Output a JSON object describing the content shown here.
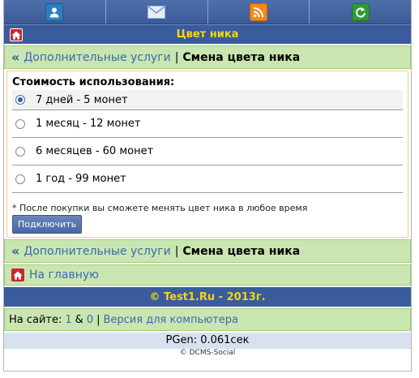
{
  "nav": {
    "icons": [
      "user-icon",
      "mail-icon",
      "rss-icon",
      "refresh-icon"
    ]
  },
  "titlebar": {
    "title": "Цвет ника"
  },
  "breadcrumb": {
    "parent": "Дополнительные услуги",
    "separator": "|",
    "current": "Смена цвета ника"
  },
  "form": {
    "label": "Стоимость использования:",
    "options": [
      {
        "label": "7 дней - 5 монет",
        "selected": true
      },
      {
        "label": "1 месяц - 12 монет",
        "selected": false
      },
      {
        "label": "6 месяцев - 60 монет",
        "selected": false
      },
      {
        "label": "1 год - 99 монет",
        "selected": false
      }
    ],
    "note": "* После покупки вы сможете менять цвет ника в любое время",
    "submit_label": "Подключить"
  },
  "home_link": "На главную",
  "footer": {
    "copyright": "© Test1.Ru - 2013г."
  },
  "online": {
    "prefix": "На сайте:",
    "count1": "1",
    "amp": "&",
    "count2": "0",
    "separator": "|",
    "desktop_link": "Версия для компьютера"
  },
  "pgen": "PGen: 0.061сек",
  "engine": "© DCMS-Social",
  "colors": {
    "nav_blue": "#3a5c9c",
    "title_yellow": "#f3d51a",
    "green_bg": "#c9e6b0",
    "link_blue": "#3a6ab0"
  }
}
